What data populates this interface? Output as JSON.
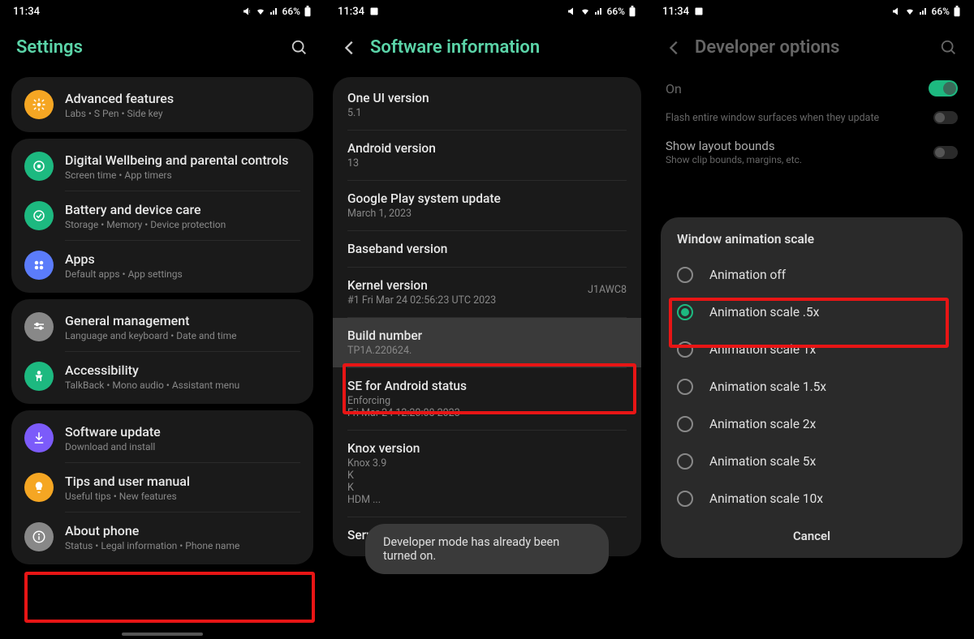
{
  "status": {
    "time": "11:34",
    "battery": "66%"
  },
  "screen1": {
    "title": "Settings",
    "items": [
      {
        "title": "Advanced features",
        "sub": "Labs • S Pen • Side key",
        "iconBg": "#f5a623",
        "icon": "gear"
      },
      {
        "title": "Digital Wellbeing and parental controls",
        "sub": "Screen time • App timers",
        "iconBg": "#1db980",
        "icon": "wellbeing"
      },
      {
        "title": "Battery and device care",
        "sub": "Storage • Memory • Device protection",
        "iconBg": "#1db980",
        "icon": "battery"
      },
      {
        "title": "Apps",
        "sub": "Default apps • App settings",
        "iconBg": "#5b7cfa",
        "icon": "apps"
      },
      {
        "title": "General management",
        "sub": "Language and keyboard • Date and time",
        "iconBg": "#888",
        "icon": "lines"
      },
      {
        "title": "Accessibility",
        "sub": "TalkBack • Mono audio • Assistant menu",
        "iconBg": "#1db980",
        "icon": "person"
      },
      {
        "title": "Software update",
        "sub": "Download and install",
        "iconBg": "#7c5bfa",
        "icon": "download"
      },
      {
        "title": "Tips and user manual",
        "sub": "Useful tips • New features",
        "iconBg": "#f5a623",
        "icon": "bulb"
      },
      {
        "title": "About phone",
        "sub": "Status • Legal information • Phone name",
        "iconBg": "#888",
        "icon": "info"
      }
    ]
  },
  "screen2": {
    "title": "Software information",
    "rows": [
      {
        "title": "One UI version",
        "sub": "5.1"
      },
      {
        "title": "Android version",
        "sub": "13"
      },
      {
        "title": "Google Play system update",
        "sub": "March 1, 2023"
      },
      {
        "title": "Baseband version"
      },
      {
        "title": "Kernel version",
        "right": "J1AWC8",
        "sub": "#1 Fri Mar 24 02:56:23 UTC 2023"
      },
      {
        "title": "Build number",
        "sub": "TP1A.220624."
      },
      {
        "title": "SE for Android status",
        "sub": "Enforcing",
        "sub2": "Fri Mar 24 12:20:08 2023"
      },
      {
        "title": "Knox version",
        "sub": "Knox 3.9",
        "sub2": "K",
        "sub3": "K",
        "sub4": "HDM ..."
      },
      {
        "title": "Service provider software version"
      }
    ],
    "toast": "Developer mode has already been turned on."
  },
  "screen3": {
    "title": "Developer options",
    "on": "On",
    "flash": "Flash entire window surfaces when they update",
    "layoutTitle": "Show layout bounds",
    "layoutSub": "Show clip bounds, margins, etc.",
    "dialog": {
      "title": "Window animation scale",
      "options": [
        "Animation off",
        "Animation scale .5x",
        "Animation scale 1x",
        "Animation scale 1.5x",
        "Animation scale 2x",
        "Animation scale 5x",
        "Animation scale 10x"
      ],
      "selected": 1,
      "cancel": "Cancel"
    }
  }
}
